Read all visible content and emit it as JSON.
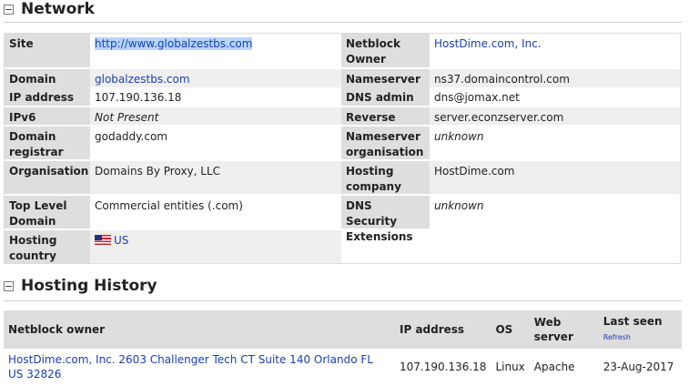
{
  "network": {
    "title": "Network",
    "left": [
      {
        "label": "Site",
        "value": "http://www.globalzestbs.com",
        "style": "link-selected"
      },
      {
        "label": "Domain",
        "value": "globalzestbs.com",
        "style": "link"
      },
      {
        "label": "IP address",
        "value": "107.190.136.18",
        "style": "text"
      },
      {
        "label": "IPv6 address",
        "value": "Not Present",
        "style": "italic"
      },
      {
        "label": "Domain registrar",
        "value": "godaddy.com",
        "style": "text"
      },
      {
        "label": "Organisation",
        "value": "Domains By Proxy, LLC",
        "style": "text"
      },
      {
        "label": "Top Level Domain",
        "value": "Commercial entities (.com)",
        "style": "text"
      },
      {
        "label": "Hosting country",
        "value": "US",
        "style": "flag-link"
      }
    ],
    "right": [
      {
        "label": "Netblock Owner",
        "value": "HostDime.com, Inc.",
        "style": "link"
      },
      {
        "label": "Nameserver",
        "value": "ns37.domaincontrol.com",
        "style": "text"
      },
      {
        "label": "DNS admin",
        "value": "dns@jomax.net",
        "style": "text"
      },
      {
        "label": "Reverse DNS",
        "value": "server.econzserver.com",
        "style": "text"
      },
      {
        "label": "Nameserver organisation",
        "value": "unknown",
        "style": "italic"
      },
      {
        "label": "Hosting company",
        "value": "HostDime.com",
        "style": "text"
      },
      {
        "label": "DNS Security Extensions",
        "value": "unknown",
        "style": "italic"
      }
    ]
  },
  "hosting_history": {
    "title": "Hosting History",
    "columns": [
      "Netblock owner",
      "IP address",
      "OS",
      "Web server",
      "Last seen"
    ],
    "refresh_label": "Refresh",
    "rows": [
      {
        "owner": "HostDime.com, Inc. 2603 Challenger Tech CT Suite 140 Orlando FL US 32826",
        "ip": "107.190.136.18",
        "os": "Linux",
        "server": "Apache",
        "last_seen": "23-Aug-2017"
      }
    ]
  }
}
